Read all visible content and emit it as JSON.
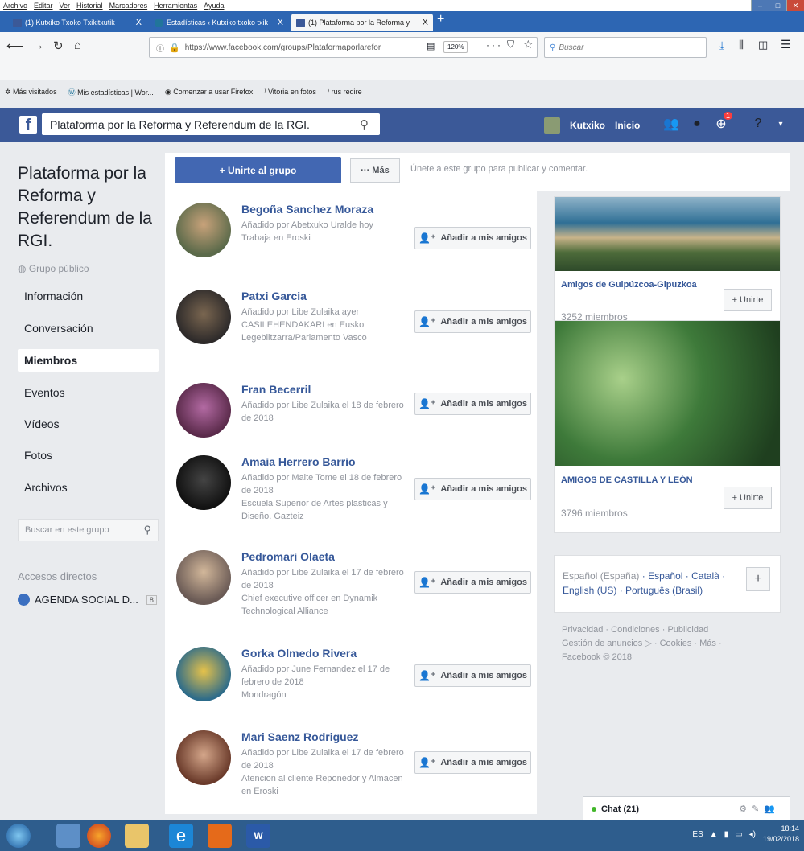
{
  "browser": {
    "menu": [
      "Archivo",
      "Editar",
      "Ver",
      "Historial",
      "Marcadores",
      "Herramientas",
      "Ayuda"
    ],
    "tabs": [
      {
        "label": "(1) Kutxiko Txoko Txikitxutik",
        "close": "X"
      },
      {
        "label": "Estadísticas ‹ Kutxiko txoko txik",
        "close": "X"
      },
      {
        "label": "(1) Plataforma por la Reforma y",
        "close": "X"
      }
    ],
    "new_tab": "+",
    "url": "https://www.facebook.com/groups/Plataformaporlarefor",
    "zoom": "120%",
    "search_placeholder": "Buscar",
    "bookmarks": [
      "Más visitados",
      "Mis estadísticas | Wor...",
      "Comenzar a usar Firefox",
      "Vitoria en fotos",
      "rus redire"
    ]
  },
  "fb": {
    "search_value": "Plataforma por la Reforma y Referendum de la RGI.",
    "user": "Kutxiko",
    "home": "Inicio",
    "notif_count": "1"
  },
  "group": {
    "name": "Plataforma por la Reforma y Referendum de la RGI.",
    "type": "Grupo público",
    "nav": [
      "Información",
      "Conversación",
      "Miembros",
      "Eventos",
      "Vídeos",
      "Fotos",
      "Archivos"
    ],
    "search_placeholder": "Buscar en este grupo",
    "shortcuts_title": "Accesos directos",
    "shortcut_label": "AGENDA SOCIAL D...",
    "shortcut_badge": "8"
  },
  "joinbar": {
    "join_label": "+ Unirte al grupo",
    "more_label": "··· Más",
    "hint": "Únete a este grupo para publicar y comentar."
  },
  "add_friend_label": "Añadir a mis amigos",
  "members": [
    {
      "name": "Begoña Sanchez Moraza",
      "lines": [
        "Añadido por Abetxuko Uralde hoy",
        "Trabaja en Eroski"
      ]
    },
    {
      "name": "Patxi Garcia",
      "lines": [
        "Añadido por Libe Zulaika ayer",
        "CASILEHENDAKARI en Eusko",
        "Legebiltzarra/Parlamento Vasco"
      ]
    },
    {
      "name": "Fran Becerril",
      "lines": [
        "Añadido por Libe Zulaika el 18 de febrero",
        "de 2018"
      ]
    },
    {
      "name": "Amaia Herrero Barrio",
      "lines": [
        "Añadido por Maite Tome el 18 de febrero",
        "de 2018",
        "Escuela Superior de Artes plasticas y",
        "Diseño. Gazteiz"
      ]
    },
    {
      "name": "Pedromari Olaeta",
      "lines": [
        "Añadido por Libe Zulaika el 17 de febrero",
        "de 2018",
        "Chief executive officer en Dynamik",
        "Technological Alliance"
      ]
    },
    {
      "name": "Gorka Olmedo Rivera",
      "lines": [
        "Añadido por June Fernandez el 17 de",
        "febrero de 2018",
        "Mondragón"
      ]
    },
    {
      "name": "Mari Saenz Rodriguez",
      "lines": [
        "Añadido por Libe Zulaika el 17 de febrero",
        "de 2018",
        "Atencion al cliente Reponedor y Almacen",
        "en Eroski"
      ]
    }
  ],
  "suggested": [
    {
      "title": "Amigos de Guipúzcoa-Gipuzkoa",
      "members": "3252 miembros",
      "join": "+ Unirte"
    },
    {
      "title": "AMIGOS DE CASTILLA Y LEÓN",
      "members": "3796 miembros",
      "join": "+ Unirte"
    }
  ],
  "languages": {
    "current": "Español (España)",
    "others": [
      "Español",
      "Català",
      "English (US)",
      "Português (Brasil)"
    ],
    "plus": "+"
  },
  "footer": {
    "links": [
      "Privacidad",
      "Condiciones",
      "Publicidad",
      "Gestión de anuncios",
      "Cookies",
      "Más"
    ],
    "copyright": "Facebook © 2018"
  },
  "chat": {
    "label": "Chat (21)"
  },
  "taskbar": {
    "lang": "ES",
    "time": "18:14",
    "date": "19/02/2018"
  },
  "colors": {
    "fb_blue": "#3b5998",
    "link": "#365899",
    "join_button": "#4267b2"
  }
}
